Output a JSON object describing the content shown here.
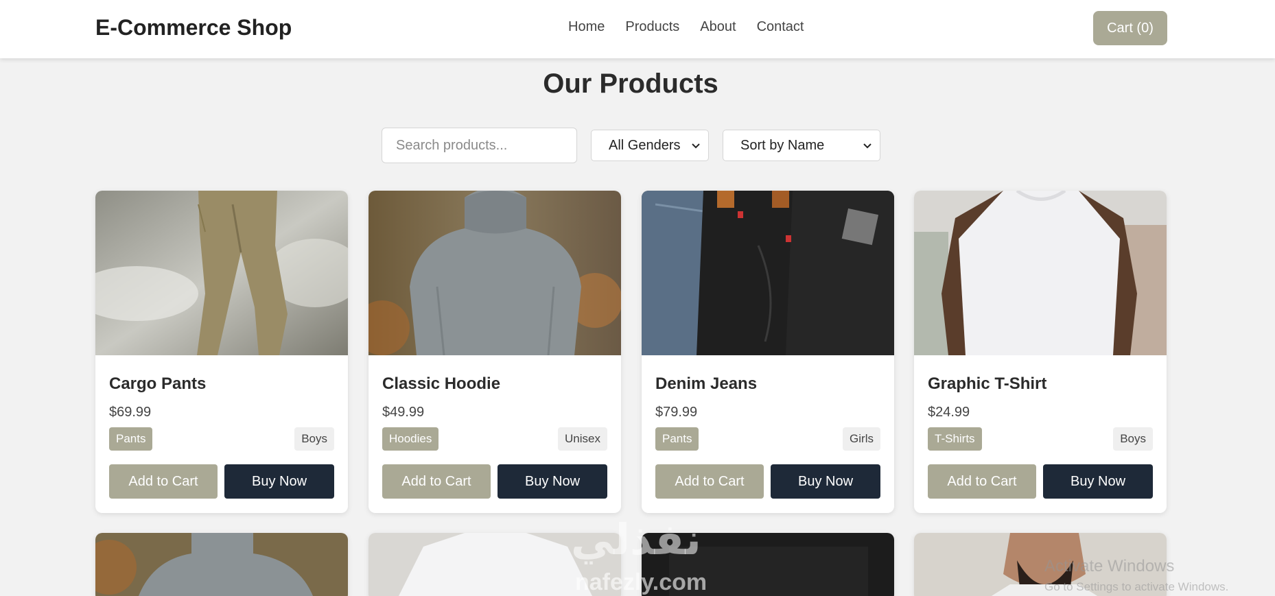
{
  "header": {
    "brand": "E-Commerce Shop",
    "nav": [
      "Home",
      "Products",
      "About",
      "Contact"
    ],
    "cart_label": "Cart (0)"
  },
  "main": {
    "title": "Our Products",
    "search_placeholder": "Search products...",
    "gender_filter": "All Genders",
    "sort_filter": "Sort by Name"
  },
  "products": [
    {
      "name": "Cargo Pants",
      "price": "$69.99",
      "category": "Pants",
      "gender": "Boys",
      "add_label": "Add to Cart",
      "buy_label": "Buy Now"
    },
    {
      "name": "Classic Hoodie",
      "price": "$49.99",
      "category": "Hoodies",
      "gender": "Unisex",
      "add_label": "Add to Cart",
      "buy_label": "Buy Now"
    },
    {
      "name": "Denim Jeans",
      "price": "$79.99",
      "category": "Pants",
      "gender": "Girls",
      "add_label": "Add to Cart",
      "buy_label": "Buy Now"
    },
    {
      "name": "Graphic T-Shirt",
      "price": "$24.99",
      "category": "T-Shirts",
      "gender": "Boys",
      "add_label": "Add to Cart",
      "buy_label": "Buy Now"
    }
  ],
  "overlays": {
    "watermark_arabic": "نفذلي",
    "watermark_url": "nafezly.com",
    "activate_title": "Activate Windows",
    "activate_sub": "Go to Settings to activate Windows."
  },
  "colors": {
    "accent": "#aaa995",
    "dark_button": "#1e2938",
    "background": "#f2f2f2"
  }
}
